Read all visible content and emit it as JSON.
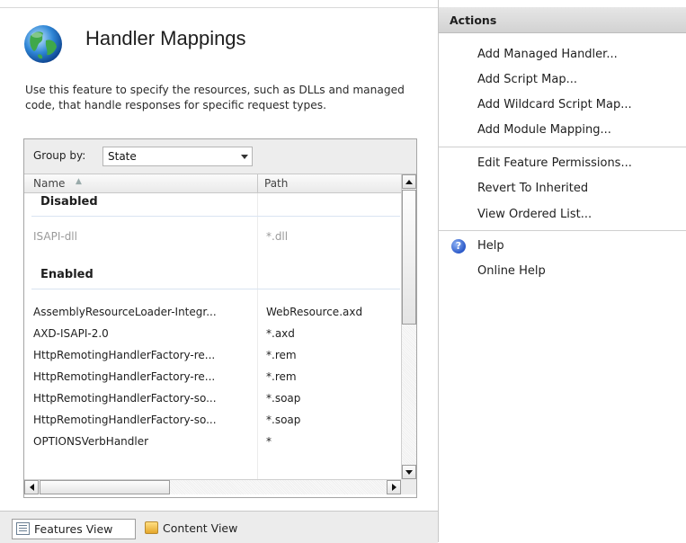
{
  "page": {
    "title": "Handler Mappings",
    "description": "Use this feature to specify the resources, such as DLLs and managed code, that handle responses for specific request types."
  },
  "grid": {
    "group_by_label": "Group by:",
    "group_by_value": "State",
    "columns": {
      "name": "Name",
      "path": "Path"
    },
    "groups": [
      {
        "label": "Disabled",
        "rows": [
          {
            "name": "ISAPI-dll",
            "path": "*.dll"
          }
        ]
      },
      {
        "label": "Enabled",
        "rows": [
          {
            "name": "AssemblyResourceLoader-Integr...",
            "path": "WebResource.axd"
          },
          {
            "name": "AXD-ISAPI-2.0",
            "path": "*.axd"
          },
          {
            "name": "HttpRemotingHandlerFactory-re...",
            "path": "*.rem"
          },
          {
            "name": "HttpRemotingHandlerFactory-re...",
            "path": "*.rem"
          },
          {
            "name": "HttpRemotingHandlerFactory-so...",
            "path": "*.soap"
          },
          {
            "name": "HttpRemotingHandlerFactory-so...",
            "path": "*.soap"
          },
          {
            "name": "OPTIONSVerbHandler",
            "path": "*"
          }
        ]
      }
    ]
  },
  "view_bar": {
    "features_view": "Features View",
    "content_view": "Content View"
  },
  "actions": {
    "title": "Actions",
    "items": [
      "Add Managed Handler...",
      "Add Script Map...",
      "Add Wildcard Script Map...",
      "Add Module Mapping...",
      "Edit Feature Permissions...",
      "Revert To Inherited",
      "View Ordered List...",
      "Help",
      "Online Help"
    ]
  },
  "icons": {
    "page_icon": "globe-icon",
    "help_icon": "help-icon",
    "features_view_icon": "features-view-icon",
    "content_view_icon": "content-view-icon",
    "sort_icon": "sort-ascending-icon"
  },
  "colors": {
    "header_bg": "#d8d8d8",
    "disabled_text": "#9a9a9a",
    "help_blue": "#2a58c8"
  }
}
